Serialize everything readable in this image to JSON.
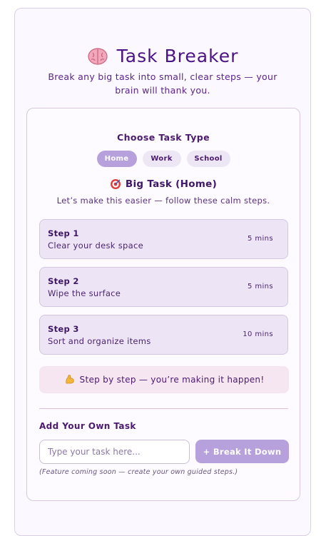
{
  "header": {
    "title": "Task Breaker",
    "icon": "brain-icon",
    "subtitle": "Break any big task into small, clear steps — your brain will thank you."
  },
  "chooser": {
    "label": "Choose Task Type",
    "tabs": [
      {
        "label": "Home",
        "active": true
      },
      {
        "label": "Work",
        "active": false
      },
      {
        "label": "School",
        "active": false
      }
    ]
  },
  "task": {
    "icon": "target-icon",
    "title": "Big Task (Home)",
    "intro": "Let’s make this easier — follow these calm steps.",
    "steps": [
      {
        "name": "Step 1",
        "description": "Clear your desk space",
        "time": "5 mins"
      },
      {
        "name": "Step 2",
        "description": "Wipe the surface",
        "time": "5 mins"
      },
      {
        "name": "Step 3",
        "description": "Sort and organize items",
        "time": "10 mins"
      }
    ],
    "encouragement_icon": "flexed-bicep-icon",
    "encouragement": "Step by step — you’re making it happen!"
  },
  "custom": {
    "label": "Add Your Own Task",
    "input_placeholder": "Type your task here...",
    "input_value": "",
    "button_label": "+ Break It Down",
    "note": "(Feature coming soon — create your own guided steps.)"
  },
  "colors": {
    "accent": "#b6a1dc",
    "title": "#4b1383",
    "step_bg": "#ede5f5",
    "encourage_bg": "#f6e6f2"
  }
}
